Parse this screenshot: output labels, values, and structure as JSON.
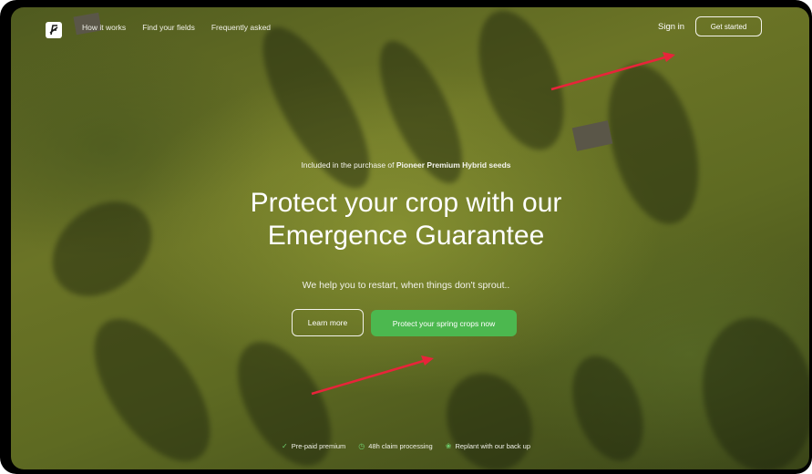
{
  "nav": {
    "links": [
      "How it works",
      "Find your fields",
      "Frequently asked"
    ],
    "signin_label": "Sign in",
    "cta_label": "Get started"
  },
  "hero": {
    "eyebrow_prefix": "Included in the purchase of ",
    "eyebrow_bold": "Pioneer Premium Hybrid seeds",
    "headline_line1": "Protect your crop with our",
    "headline_line2": "Emergence Guarantee",
    "subhead": "We help you to restart, when things don't sprout..",
    "learn_more_label": "Learn more",
    "primary_cta_label": "Protect your spring crops now"
  },
  "features": [
    {
      "icon": "check-circle-icon",
      "label": "Pre-paid premium"
    },
    {
      "icon": "clock-icon",
      "label": "48h claim processing"
    },
    {
      "icon": "sprout-icon",
      "label": "Replant with our back up"
    }
  ],
  "colors": {
    "accent": "#4cb84f",
    "annotation_arrow": "#e8243a"
  }
}
